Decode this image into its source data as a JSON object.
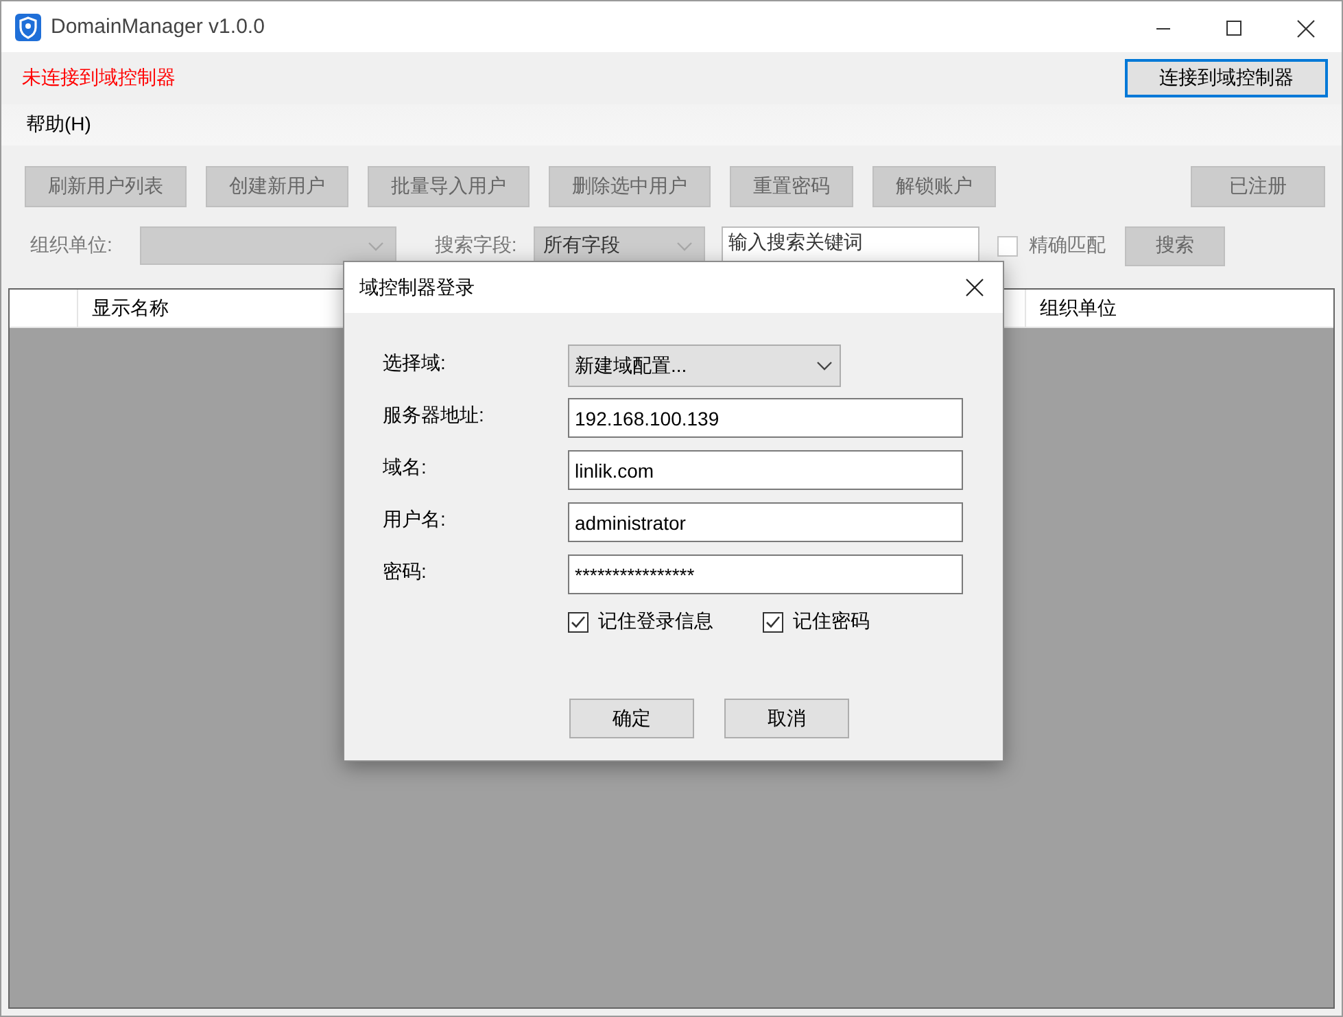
{
  "window": {
    "title": "DomainManager v1.0.0"
  },
  "status": {
    "text": "未连接到域控制器",
    "connected": false
  },
  "connect_button": {
    "label": "连接到域控制器",
    "focused": true
  },
  "menu": [
    {
      "label": "帮助(H)"
    }
  ],
  "toolbar": {
    "buttons": [
      {
        "label": "刷新用户列表",
        "disabled": true
      },
      {
        "label": "创建新用户",
        "disabled": true
      },
      {
        "label": "批量导入用户",
        "disabled": true
      },
      {
        "label": "删除选中用户",
        "disabled": true
      },
      {
        "label": "重置密码",
        "disabled": true
      },
      {
        "label": "解锁账户",
        "disabled": true
      }
    ],
    "register_button": {
      "label": "已注册",
      "disabled": true
    }
  },
  "filter": {
    "ou_label": "组织单位:",
    "ou_dropdown": {
      "disabled": true
    },
    "field_label": "搜索字段:",
    "field_dropdown": {
      "value": "所有字段",
      "disabled": true
    },
    "search_field": {
      "placeholder": "输入搜索关键词"
    },
    "exact_match": {
      "label": "精确匹配",
      "checked": false,
      "disabled": true
    },
    "search_button": {
      "label": "搜索",
      "disabled": true
    }
  },
  "table": {
    "columns": [
      {},
      {
        "label": "显示名称"
      },
      {
        "label": "组织单位"
      }
    ]
  },
  "dialog": {
    "title": "域控制器登录",
    "fields": [
      {
        "label": "选择域:",
        "kind": "select",
        "value": "新建域配置..."
      },
      {
        "label": "服务器地址:",
        "kind": "text",
        "value": "192.168.100.139"
      },
      {
        "label": "域名:",
        "kind": "text",
        "value": "linlik.com"
      },
      {
        "label": "用户名:",
        "kind": "text",
        "value": "administrator"
      },
      {
        "label": "密码:",
        "kind": "text",
        "value": "****************"
      }
    ],
    "checkboxes": [
      {
        "label": "记住登录信息",
        "checked": true
      },
      {
        "label": "记住密码",
        "checked": true
      }
    ],
    "buttons": [
      {
        "label": "确定"
      },
      {
        "label": "取消"
      }
    ]
  }
}
